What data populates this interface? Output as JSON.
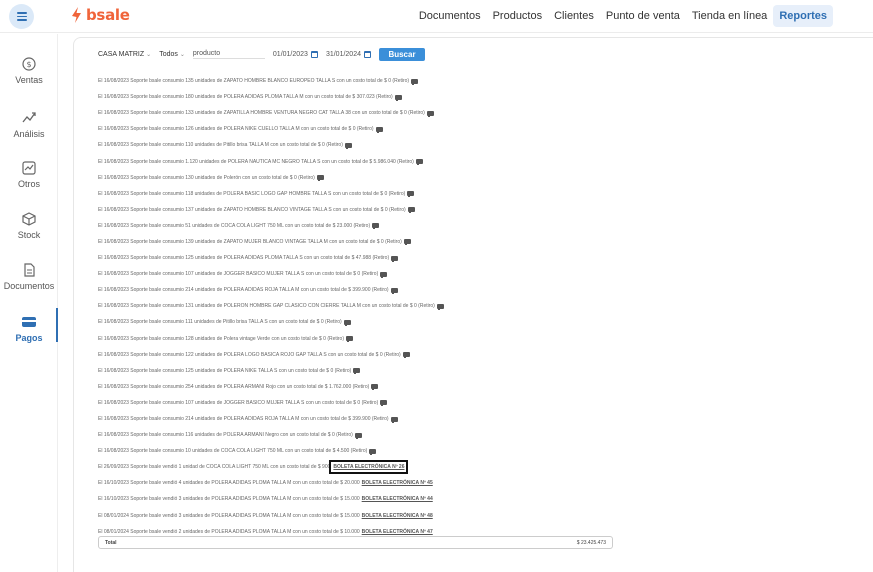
{
  "brand": {
    "name": "bsale"
  },
  "topnav": [
    {
      "label": "Documentos",
      "active": false
    },
    {
      "label": "Productos",
      "active": false
    },
    {
      "label": "Clientes",
      "active": false
    },
    {
      "label": "Punto de venta",
      "active": false
    },
    {
      "label": "Tienda en línea",
      "active": false
    },
    {
      "label": "Reportes",
      "active": true
    }
  ],
  "sidebar": [
    {
      "label": "Ventas",
      "icon": "dollar-circle-icon"
    },
    {
      "label": "Análisis",
      "icon": "analytics-icon"
    },
    {
      "label": "Otros",
      "icon": "chart-box-icon"
    },
    {
      "label": "Stock",
      "icon": "box-icon"
    },
    {
      "label": "Documentos",
      "icon": "document-icon"
    },
    {
      "label": "Pagos",
      "icon": "payment-card-icon",
      "active": true
    }
  ],
  "filters": {
    "branch": "CASA MATRIZ",
    "scope": "Todos",
    "product_placeholder": "producto",
    "date_from": "01/01/2023",
    "date_to": "31/01/2024",
    "search_label": "Buscar"
  },
  "rows": [
    {
      "text": "El 16/08/2023 Soporte bsale consumio 135 unidades de ZAPATO HOMBRE BLANCO EUROPEO TALLA S con un costo total de $ 0 (Retiro)"
    },
    {
      "text": "El 16/08/2023 Soporte bsale consumio 180 unidades de POLERA ADIDAS PLOMA TALLA M con un costo total de $ 307.023 (Retiro)"
    },
    {
      "text": "El 16/08/2023 Soporte bsale consumio 133 unidades de ZAPATILLA HOMBRE VENTURA NEGRO CAT TALLA 38 con un costo total de $ 0 (Retiro)"
    },
    {
      "text": "El 16/08/2023 Soporte bsale consumio 126 unidades de POLERA NIKE CUELLO TALLA M con un costo total de $ 0 (Retiro)"
    },
    {
      "text": "El 16/08/2023 Soporte bsale consumio 110 unidades de Pitillo brisa TALLA M con un costo total de $ 0 (Retiro)"
    },
    {
      "text": "El 16/08/2023 Soporte bsale consumio 1.120 unidades de POLERA NAUTICA MC NEGRO TALLA S con un costo total de $ 5.986.040 (Retiro)"
    },
    {
      "text": "El 16/08/2023 Soporte bsale consumio 130 unidades de Polerón con un costo total de $ 0 (Retiro)"
    },
    {
      "text": "El 16/08/2023 Soporte bsale consumio 118 unidades de POLERA BASIC LOGO GAP HOMBRE TALLA S con un costo total de $ 0 (Retiro)"
    },
    {
      "text": "El 16/08/2023 Soporte bsale consumio 137 unidades de ZAPATO HOMBRE BLANCO VINTAGE TALLA S con un costo total de $ 0 (Retiro)"
    },
    {
      "text": "El 16/08/2023 Soporte bsale consumio 51 unidades de COCA COLA LIGHT 750 ML con un costo total de $ 23.000 (Retiro)"
    },
    {
      "text": "El 16/08/2023 Soporte bsale consumio 139 unidades de ZAPATO MUJER BLANCO VINTAGE TALLA M con un costo total de $ 0 (Retiro)"
    },
    {
      "text": "El 16/08/2023 Soporte bsale consumio 125 unidades de POLERA ADIDAS PLOMA TALLA S con un costo total de $ 47.988 (Retiro)"
    },
    {
      "text": "El 16/08/2023 Soporte bsale consumio 107 unidades de JOGGER BASICO MUJER TALLA S con un costo total de $ 0 (Retiro)"
    },
    {
      "text": "El 16/08/2023 Soporte bsale consumio 214 unidades de POLERA ADIDAS ROJA TALLA M con un costo total de $ 399.900 (Retiro)"
    },
    {
      "text": "El 16/08/2023 Soporte bsale consumio 131 unidades de POLERON HOMBRE GAP CLASICO CON CIERRE TALLA M con un costo total de $ 0 (Retiro)"
    },
    {
      "text": "El 16/08/2023 Soporte bsale consumio 111 unidades de Pitillo brisa TALLA S con un costo total de $ 0 (Retiro)"
    },
    {
      "text": "El 16/08/2023 Soporte bsale consumio 128 unidades de Polera vintage Verde con un costo total de $ 0 (Retiro)"
    },
    {
      "text": "El 16/08/2023 Soporte bsale consumio 122 unidades de POLERA LOGO BASICA ROJO GAP TALLA S con un costo total de $ 0 (Retiro)"
    },
    {
      "text": "El 16/08/2023 Soporte bsale consumio 125 unidades de POLERA NIKE TALLA S con un costo total de $ 0 (Retiro)"
    },
    {
      "text": "El 16/08/2023 Soporte bsale consumio 254 unidades de POLERA ARMANI Rojo con un costo total de $ 1.762.000 (Retiro)"
    },
    {
      "text": "El 16/08/2023 Soporte bsale consumio 107 unidades de JOGGER BASICO MUJER TALLA S con un costo total de $ 0 (Retiro)"
    },
    {
      "text": "El 16/08/2023 Soporte bsale consumio 214 unidades de POLERA ADIDAS ROJA TALLA M con un costo total de $ 399.900 (Retiro)"
    },
    {
      "text": "El 16/08/2023 Soporte bsale consumio 116 unidades de POLERA ARMANI Negro con un costo total de $ 0 (Retiro)"
    },
    {
      "text": "El 16/08/2023 Soporte bsale consumio 10 unidades de COCA COLA LIGHT 750 ML con un costo total de $ 4.500 (Retiro)"
    },
    {
      "text": "El 26/09/2023 Soporte bsale vendió 1 unidad de COCA COLA LIGHT 750 ML con un costo total de $ 900",
      "link": "BOLETA ELECTRÓNICA Nº 26"
    },
    {
      "text": "El 16/10/2023 Soporte bsale vendió 4 unidades de POLERA ADIDAS PLOMA TALLA M con un costo total de $ 20.000",
      "link": "BOLETA ELECTRÓNICA Nº 45"
    },
    {
      "text": "El 16/10/2023 Soporte bsale vendió 3 unidades de POLERA ADIDAS PLOMA TALLA M con un costo total de $ 15.000",
      "link": "BOLETA ELECTRÓNICA Nº 44"
    },
    {
      "text": "El 08/01/2024 Soporte bsale vendió 3 unidades de POLERA ADIDAS PLOMA TALLA M con un costo total de $ 15.000",
      "link": "BOLETA ELECTRÓNICA Nº 48"
    },
    {
      "text": "El 08/01/2024 Soporte bsale vendió 2 unidades de POLERA ADIDAS PLOMA TALLA M con un costo total de $ 10.000",
      "link": "BOLETA ELECTRÓNICA Nº 47"
    }
  ],
  "total": {
    "label": "Total",
    "value": "$ 23.425.473"
  },
  "colors": {
    "accent": "#2f6fb3",
    "brand": "#f0643a",
    "button": "#3b8fd9"
  }
}
